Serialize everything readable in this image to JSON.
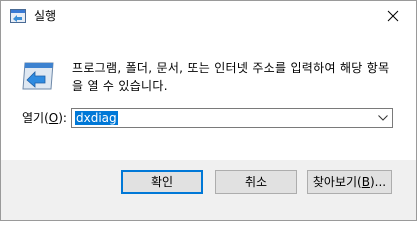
{
  "window": {
    "title": "실행",
    "close_icon": "close-icon",
    "title_icon": "run-icon"
  },
  "content": {
    "description": "프로그램, 폴더, 문서, 또는 인터넷 주소를 입력하여 해당 항목을 열 수 있습니다.",
    "open_label_main": "열기",
    "open_label_hotkey_open": "(",
    "open_label_hotkey": "O",
    "open_label_hotkey_close": "):",
    "open_value": "dxdiag",
    "dropdown_icon": "chevron-down-icon"
  },
  "buttons": {
    "ok": "확인",
    "cancel": "취소",
    "browse_main": "찾아보기(",
    "browse_hotkey": "B",
    "browse_end": ")..."
  },
  "colors": {
    "selection": "#0078d7",
    "footer_bg": "#f0f0f0",
    "button_bg": "#e1e1e1",
    "accent": "#0078d7"
  }
}
